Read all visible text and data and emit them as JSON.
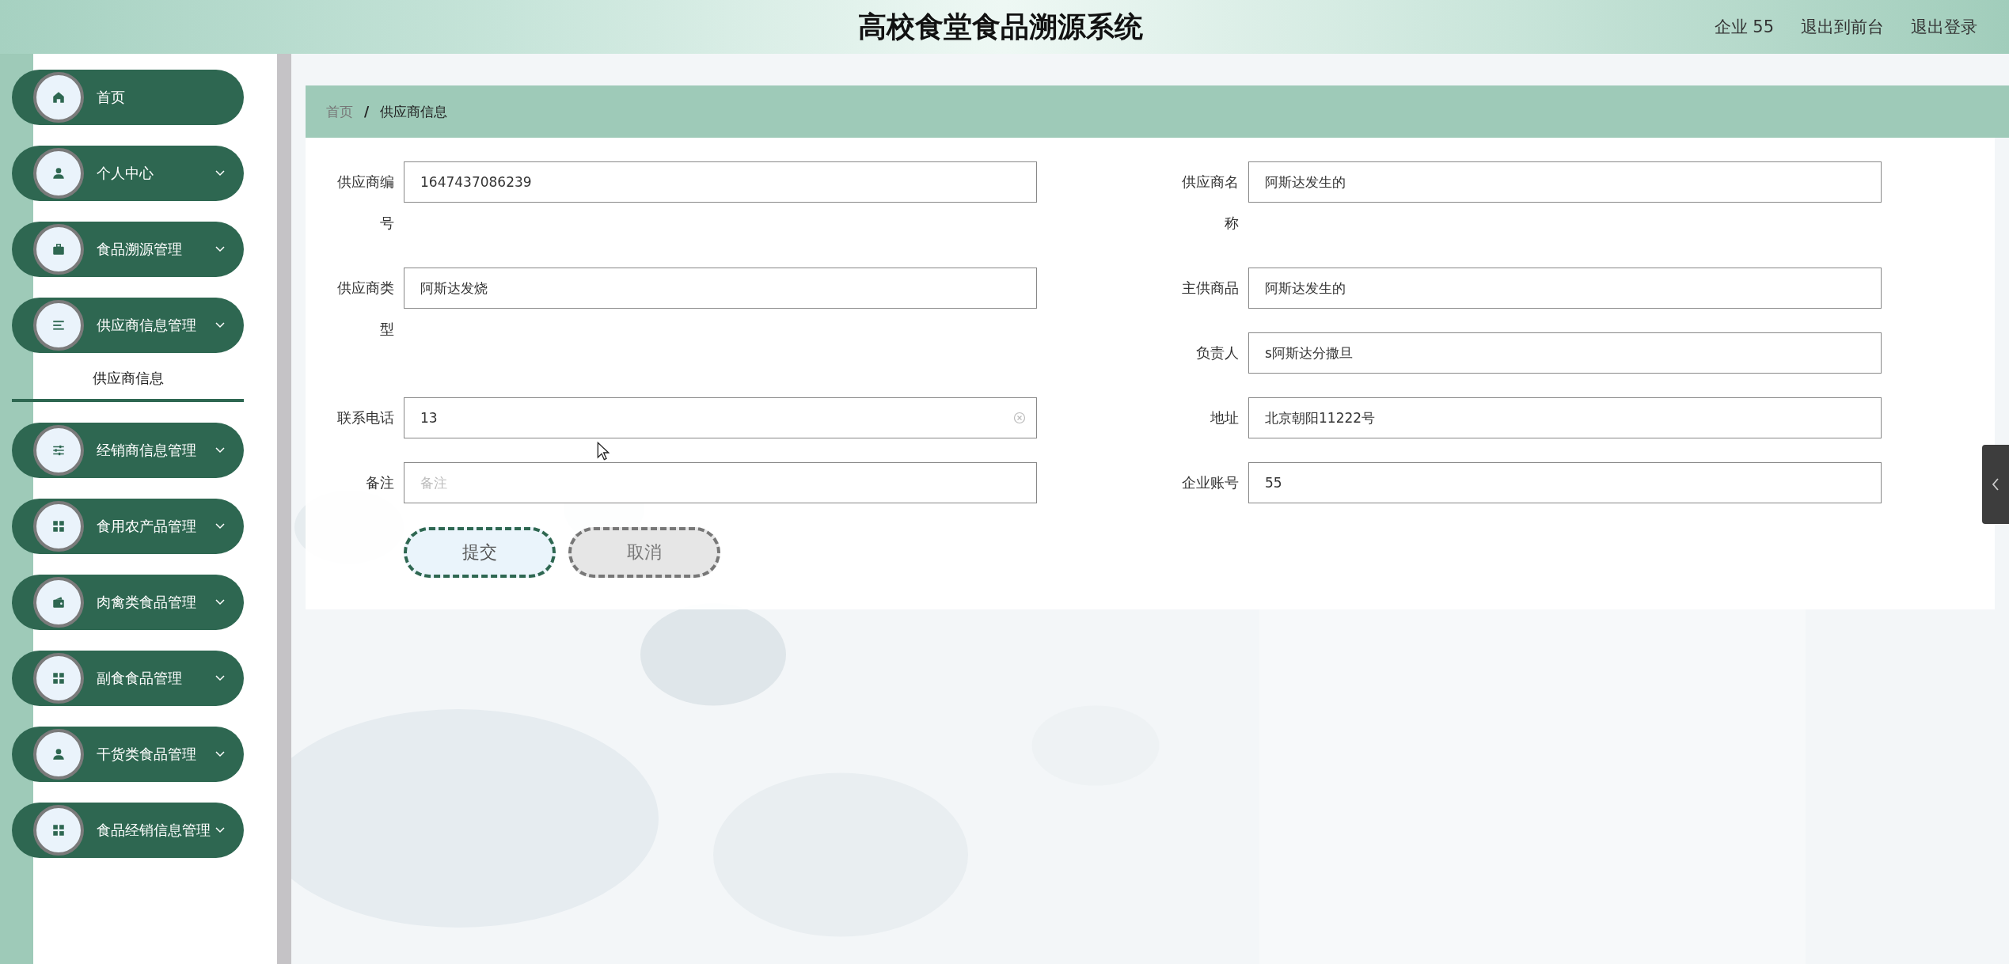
{
  "header": {
    "title": "高校食堂食品溯源系统",
    "links": [
      "企业 55",
      "退出到前台",
      "退出登录"
    ]
  },
  "sidebar": {
    "items": [
      {
        "label": "首页",
        "expandable": false
      },
      {
        "label": "个人中心",
        "expandable": true
      },
      {
        "label": "食品溯源管理",
        "expandable": true
      },
      {
        "label": "供应商信息管理",
        "expandable": true,
        "children": [
          {
            "label": "供应商信息",
            "selected": true
          }
        ]
      },
      {
        "label": "经销商信息管理",
        "expandable": true
      },
      {
        "label": "食用农产品管理",
        "expandable": true
      },
      {
        "label": "肉禽类食品管理",
        "expandable": true
      },
      {
        "label": "副食食品管理",
        "expandable": true
      },
      {
        "label": "干货类食品管理",
        "expandable": true
      },
      {
        "label": "食品经销信息管理",
        "expandable": true
      }
    ]
  },
  "breadcrumb": {
    "separator": "/",
    "items": [
      {
        "label": "首页",
        "current": false
      },
      {
        "label": "供应商信息",
        "current": true
      }
    ]
  },
  "form": {
    "fields": [
      {
        "label": "供应商编号",
        "value": "1647437086239",
        "clearable": false
      },
      {
        "label": "供应商名称",
        "value": "阿斯达发生的",
        "clearable": false
      },
      {
        "label": "供应商类型",
        "value": "阿斯达发烧",
        "clearable": false
      },
      {
        "label": "主供商品",
        "value": "阿斯达发生的",
        "clearable": false
      },
      {
        "label": "负责人",
        "value": "s阿斯达分撒旦",
        "clearable": false
      },
      {
        "label": "联系电话",
        "value": "13",
        "clearable": true
      },
      {
        "label": "地址",
        "value": "北京朝阳11222号",
        "clearable": false
      },
      {
        "label": "备注",
        "placeholder": "备注",
        "clearable": false
      },
      {
        "label": "企业账号",
        "value": "55",
        "clearable": false
      }
    ],
    "buttons": [
      {
        "label": "提交",
        "kind": "primary"
      },
      {
        "label": "取消",
        "kind": "cancel"
      }
    ]
  }
}
